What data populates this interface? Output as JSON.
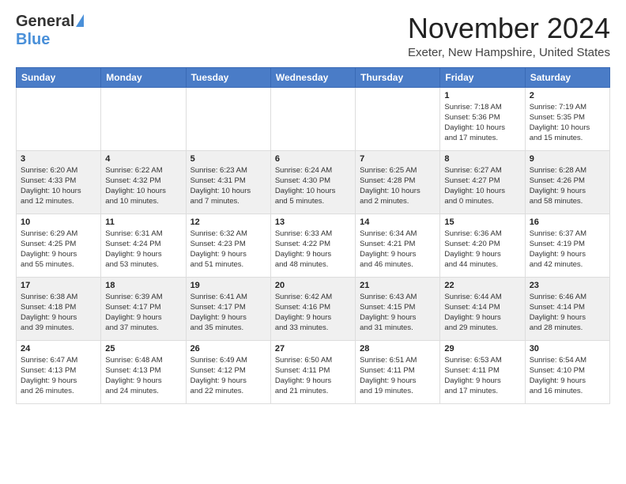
{
  "logo": {
    "general": "General",
    "blue": "Blue"
  },
  "title": "November 2024",
  "subtitle": "Exeter, New Hampshire, United States",
  "days_of_week": [
    "Sunday",
    "Monday",
    "Tuesday",
    "Wednesday",
    "Thursday",
    "Friday",
    "Saturday"
  ],
  "weeks": [
    [
      {
        "day": "",
        "info": ""
      },
      {
        "day": "",
        "info": ""
      },
      {
        "day": "",
        "info": ""
      },
      {
        "day": "",
        "info": ""
      },
      {
        "day": "",
        "info": ""
      },
      {
        "day": "1",
        "info": "Sunrise: 7:18 AM\nSunset: 5:36 PM\nDaylight: 10 hours\nand 17 minutes."
      },
      {
        "day": "2",
        "info": "Sunrise: 7:19 AM\nSunset: 5:35 PM\nDaylight: 10 hours\nand 15 minutes."
      }
    ],
    [
      {
        "day": "3",
        "info": "Sunrise: 6:20 AM\nSunset: 4:33 PM\nDaylight: 10 hours\nand 12 minutes."
      },
      {
        "day": "4",
        "info": "Sunrise: 6:22 AM\nSunset: 4:32 PM\nDaylight: 10 hours\nand 10 minutes."
      },
      {
        "day": "5",
        "info": "Sunrise: 6:23 AM\nSunset: 4:31 PM\nDaylight: 10 hours\nand 7 minutes."
      },
      {
        "day": "6",
        "info": "Sunrise: 6:24 AM\nSunset: 4:30 PM\nDaylight: 10 hours\nand 5 minutes."
      },
      {
        "day": "7",
        "info": "Sunrise: 6:25 AM\nSunset: 4:28 PM\nDaylight: 10 hours\nand 2 minutes."
      },
      {
        "day": "8",
        "info": "Sunrise: 6:27 AM\nSunset: 4:27 PM\nDaylight: 10 hours\nand 0 minutes."
      },
      {
        "day": "9",
        "info": "Sunrise: 6:28 AM\nSunset: 4:26 PM\nDaylight: 9 hours\nand 58 minutes."
      }
    ],
    [
      {
        "day": "10",
        "info": "Sunrise: 6:29 AM\nSunset: 4:25 PM\nDaylight: 9 hours\nand 55 minutes."
      },
      {
        "day": "11",
        "info": "Sunrise: 6:31 AM\nSunset: 4:24 PM\nDaylight: 9 hours\nand 53 minutes."
      },
      {
        "day": "12",
        "info": "Sunrise: 6:32 AM\nSunset: 4:23 PM\nDaylight: 9 hours\nand 51 minutes."
      },
      {
        "day": "13",
        "info": "Sunrise: 6:33 AM\nSunset: 4:22 PM\nDaylight: 9 hours\nand 48 minutes."
      },
      {
        "day": "14",
        "info": "Sunrise: 6:34 AM\nSunset: 4:21 PM\nDaylight: 9 hours\nand 46 minutes."
      },
      {
        "day": "15",
        "info": "Sunrise: 6:36 AM\nSunset: 4:20 PM\nDaylight: 9 hours\nand 44 minutes."
      },
      {
        "day": "16",
        "info": "Sunrise: 6:37 AM\nSunset: 4:19 PM\nDaylight: 9 hours\nand 42 minutes."
      }
    ],
    [
      {
        "day": "17",
        "info": "Sunrise: 6:38 AM\nSunset: 4:18 PM\nDaylight: 9 hours\nand 39 minutes."
      },
      {
        "day": "18",
        "info": "Sunrise: 6:39 AM\nSunset: 4:17 PM\nDaylight: 9 hours\nand 37 minutes."
      },
      {
        "day": "19",
        "info": "Sunrise: 6:41 AM\nSunset: 4:17 PM\nDaylight: 9 hours\nand 35 minutes."
      },
      {
        "day": "20",
        "info": "Sunrise: 6:42 AM\nSunset: 4:16 PM\nDaylight: 9 hours\nand 33 minutes."
      },
      {
        "day": "21",
        "info": "Sunrise: 6:43 AM\nSunset: 4:15 PM\nDaylight: 9 hours\nand 31 minutes."
      },
      {
        "day": "22",
        "info": "Sunrise: 6:44 AM\nSunset: 4:14 PM\nDaylight: 9 hours\nand 29 minutes."
      },
      {
        "day": "23",
        "info": "Sunrise: 6:46 AM\nSunset: 4:14 PM\nDaylight: 9 hours\nand 28 minutes."
      }
    ],
    [
      {
        "day": "24",
        "info": "Sunrise: 6:47 AM\nSunset: 4:13 PM\nDaylight: 9 hours\nand 26 minutes."
      },
      {
        "day": "25",
        "info": "Sunrise: 6:48 AM\nSunset: 4:13 PM\nDaylight: 9 hours\nand 24 minutes."
      },
      {
        "day": "26",
        "info": "Sunrise: 6:49 AM\nSunset: 4:12 PM\nDaylight: 9 hours\nand 22 minutes."
      },
      {
        "day": "27",
        "info": "Sunrise: 6:50 AM\nSunset: 4:11 PM\nDaylight: 9 hours\nand 21 minutes."
      },
      {
        "day": "28",
        "info": "Sunrise: 6:51 AM\nSunset: 4:11 PM\nDaylight: 9 hours\nand 19 minutes."
      },
      {
        "day": "29",
        "info": "Sunrise: 6:53 AM\nSunset: 4:11 PM\nDaylight: 9 hours\nand 17 minutes."
      },
      {
        "day": "30",
        "info": "Sunrise: 6:54 AM\nSunset: 4:10 PM\nDaylight: 9 hours\nand 16 minutes."
      }
    ]
  ]
}
